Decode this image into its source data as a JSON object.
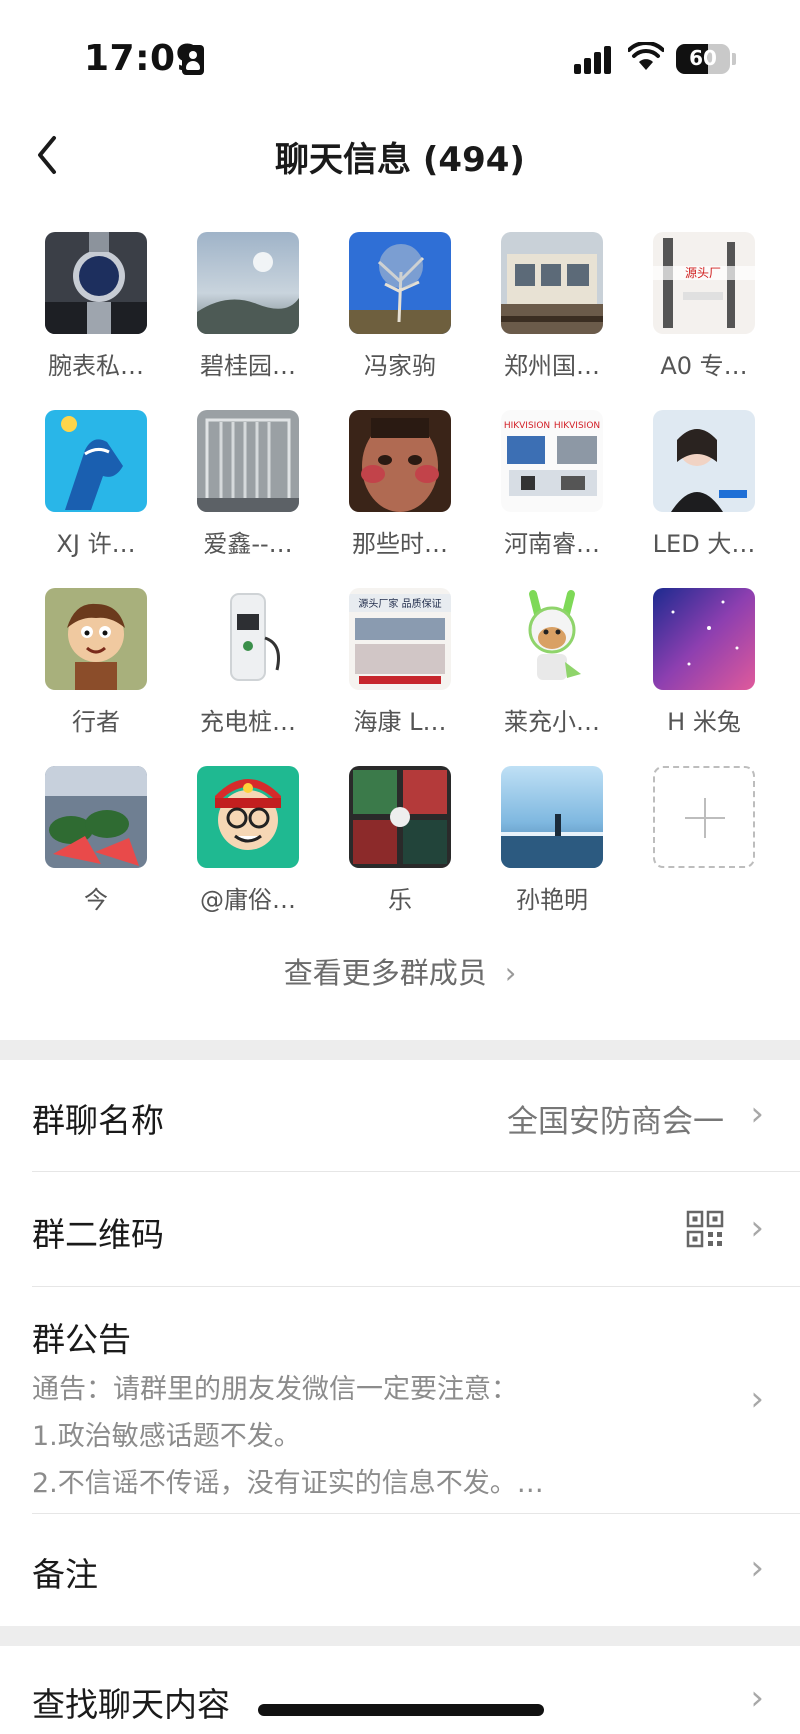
{
  "status_bar": {
    "time": "17:09",
    "battery_level": "60"
  },
  "nav": {
    "title": "聊天信息 (494)"
  },
  "members": [
    {
      "name": "腕表私…"
    },
    {
      "name": "碧桂园…"
    },
    {
      "name": "冯家驹"
    },
    {
      "name": "郑州国…"
    },
    {
      "name": "A0 专…"
    },
    {
      "name": "XJ 许…"
    },
    {
      "name": "爱鑫--…"
    },
    {
      "name": "那些时…"
    },
    {
      "name": "河南睿…"
    },
    {
      "name": "LED 大…"
    },
    {
      "name": "行者"
    },
    {
      "name": "充电桩…"
    },
    {
      "name": "海康 L…"
    },
    {
      "name": "莱充小…"
    },
    {
      "name": "H 米兔"
    },
    {
      "name": "今"
    },
    {
      "name": "@庸俗…"
    },
    {
      "name": "乐"
    },
    {
      "name": "孙艳明"
    }
  ],
  "avatar_text": {
    "a5": "源头厂",
    "a9": "HIKVISION",
    "a13": "源头厂家 品质保证"
  },
  "view_more": {
    "label": "查看更多群成员"
  },
  "settings": {
    "group_name": {
      "label": "群聊名称",
      "value": "全国安防商会一"
    },
    "qr_code": {
      "label": "群二维码"
    },
    "announcement": {
      "label": "群公告",
      "lines": [
        "通告：请群里的朋友发微信一定要注意：",
        "1.政治敏感话题不发。",
        "2.不信谣不传谣，没有证实的信息不发。…"
      ]
    },
    "remark": {
      "label": "备注"
    },
    "search_chat": {
      "label": "查找聊天内容"
    }
  },
  "colors": {
    "separator": "#ededed",
    "secondary_text": "#8c8c8c"
  }
}
